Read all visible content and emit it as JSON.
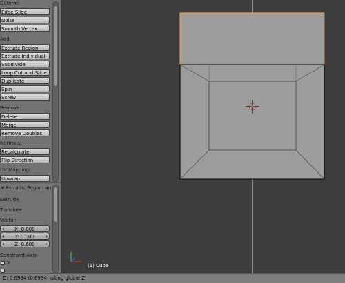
{
  "toolshelf": {
    "deform_heading": "Deform:",
    "deform_buttons": [
      "Edge Slide",
      "Noise",
      "Smooth Vertex"
    ],
    "add_heading": "Add:",
    "add_buttons": [
      "Extrude Region",
      "Extrude Individual",
      "Subdivide",
      "Loop Cut and Slide",
      "Duplicate",
      "Spin",
      "Screw"
    ],
    "remove_heading": "Remove:",
    "remove_buttons": [
      "Delete",
      "Merge",
      "Remove Doubles"
    ],
    "normals_heading": "Normals:",
    "normals_buttons": [
      "Recalculate",
      "Flip Direction"
    ],
    "uv_heading": "UV Mapping:",
    "uv_buttons": [
      "Unwrap"
    ]
  },
  "operator_panel": {
    "title": "Extrudic Region and",
    "extrude_label": "Extrude",
    "translate_label": "Translate",
    "vector_label": "Vector",
    "vector": {
      "x": "X: 0.000",
      "y": "Y: 0.000",
      "z": "Z: 0.680"
    },
    "constraint_label": "Constraint Axis",
    "constraint_x": "X"
  },
  "viewport": {
    "object_label": "(1) Cube",
    "colors": {
      "background": "#3d3d3d",
      "face": "#9d9d9d",
      "selected_edge": "#e89b3c",
      "edge": "#000000"
    }
  },
  "status": {
    "text": "D: 0.6994 (0.6994) along global Z"
  }
}
